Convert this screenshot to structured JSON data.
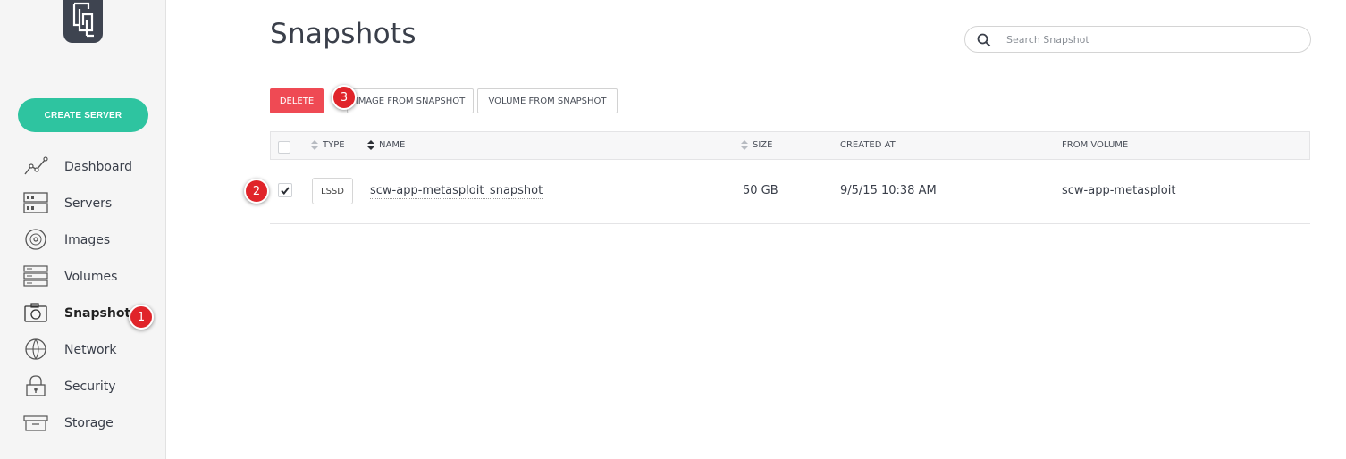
{
  "sidebar": {
    "create_button": "CREATE SERVER",
    "items": [
      {
        "label": "Dashboard",
        "icon": "dashboard-icon"
      },
      {
        "label": "Servers",
        "icon": "servers-icon"
      },
      {
        "label": "Images",
        "icon": "images-icon"
      },
      {
        "label": "Volumes",
        "icon": "volumes-icon"
      },
      {
        "label": "Snapshots",
        "icon": "snapshots-icon"
      },
      {
        "label": "Network",
        "icon": "network-icon"
      },
      {
        "label": "Security",
        "icon": "security-icon"
      },
      {
        "label": "Storage",
        "icon": "storage-icon"
      }
    ],
    "active_item": "Snapshots"
  },
  "header": {
    "title": "Snapshots",
    "search_placeholder": "Search Snapshot"
  },
  "toolbar": {
    "delete_label": "DELETE",
    "image_label": "IMAGE FROM SNAPSHOT",
    "volume_label": "VOLUME FROM SNAPSHOT"
  },
  "table": {
    "columns": [
      "TYPE",
      "NAME",
      "SIZE",
      "CREATED AT",
      "FROM VOLUME"
    ],
    "rows": [
      {
        "checked": true,
        "type": "LSSD",
        "name": "scw-app-metasploit_snapshot",
        "size": "50 GB",
        "created_at": "9/5/15 10:38 AM",
        "from_volume": "scw-app-metasploit"
      }
    ]
  },
  "annotations": [
    "1",
    "2",
    "3"
  ],
  "colors": {
    "accent_green": "#2ec4a0",
    "danger_red": "#ef4a54",
    "badge_red": "#e0242a",
    "sidebar_bg": "#f5f5f5"
  }
}
